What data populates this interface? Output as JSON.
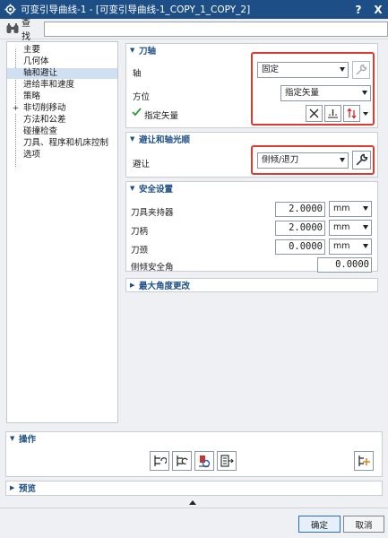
{
  "window": {
    "title": "可变引导曲线-1 - [可变引导曲线-1_COPY_1_COPY_2]",
    "help_label": "?",
    "close_label": "X"
  },
  "find": {
    "label": "查找",
    "value": ""
  },
  "nav": {
    "items": [
      {
        "label": "主要"
      },
      {
        "label": "几何体"
      },
      {
        "label": "轴和避让",
        "selected": true
      },
      {
        "label": "进给率和速度"
      },
      {
        "label": "策略"
      },
      {
        "label": "非切削移动",
        "expandable": true
      },
      {
        "label": "方法和公差"
      },
      {
        "label": "碰撞检查"
      },
      {
        "label": "刀具、程序和机床控制"
      },
      {
        "label": "选项"
      }
    ],
    "expand_symbol": "+"
  },
  "tool_axis": {
    "header": "刀轴",
    "axis_label": "轴",
    "axis_value": "固定",
    "orientation_label": "方位",
    "orientation_value": "指定矢量",
    "vector_label": "指定矢量"
  },
  "avoidance": {
    "header": "避让和轴光顺",
    "label": "避让",
    "value": "侧倾/退刀"
  },
  "clearance": {
    "header": "安全设置",
    "rows": [
      {
        "label": "刀具夹持器",
        "value": "2.0000",
        "unit": "mm"
      },
      {
        "label": "刀柄",
        "value": "2.0000",
        "unit": "mm"
      },
      {
        "label": "刀颈",
        "value": "0.0000",
        "unit": "mm"
      }
    ],
    "tilt_label": "侧倾安全角",
    "tilt_value": "0.0000"
  },
  "max_angle": {
    "header": "最大角度更改"
  },
  "operations": {
    "header": "操作"
  },
  "preview": {
    "header": "预览"
  },
  "buttons": {
    "ok": "确定",
    "cancel": "取消"
  },
  "colors": {
    "titlebar": "#1d4f86",
    "highlight": "#e03a2f",
    "accent": "#1d4f86"
  }
}
